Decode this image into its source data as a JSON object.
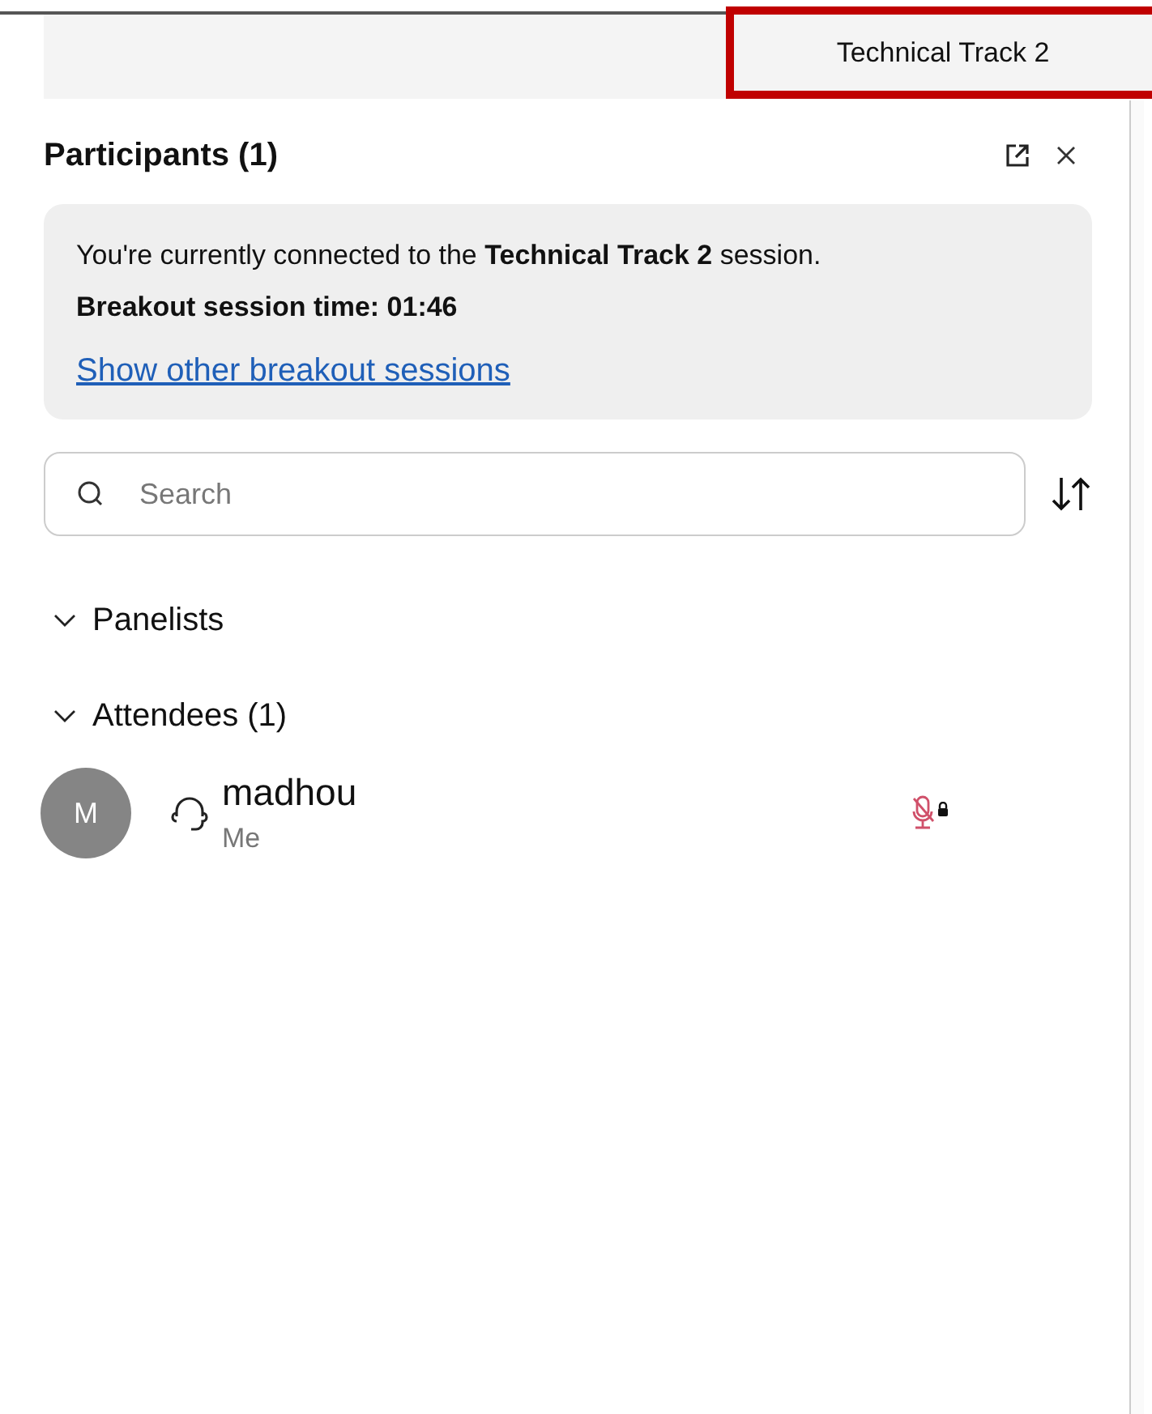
{
  "session_tab": {
    "label": "Technical Track 2"
  },
  "panel": {
    "title": "Participants (1)"
  },
  "info": {
    "text": "You're currently connected to the **Technical Track 2** session.",
    "timer": "Breakout session time: 01:46",
    "link": "Show other breakout sessions"
  },
  "search": {
    "placeholder": "Search"
  },
  "sections": [
    {
      "label": "Panelists",
      "expanded": true
    },
    {
      "label": "Attendees (1)",
      "expanded": true,
      "participants": [
        {
          "initial": "M",
          "name": "madhou",
          "subtitle": "Me",
          "muted": true,
          "locked": true
        }
      ]
    }
  ]
}
